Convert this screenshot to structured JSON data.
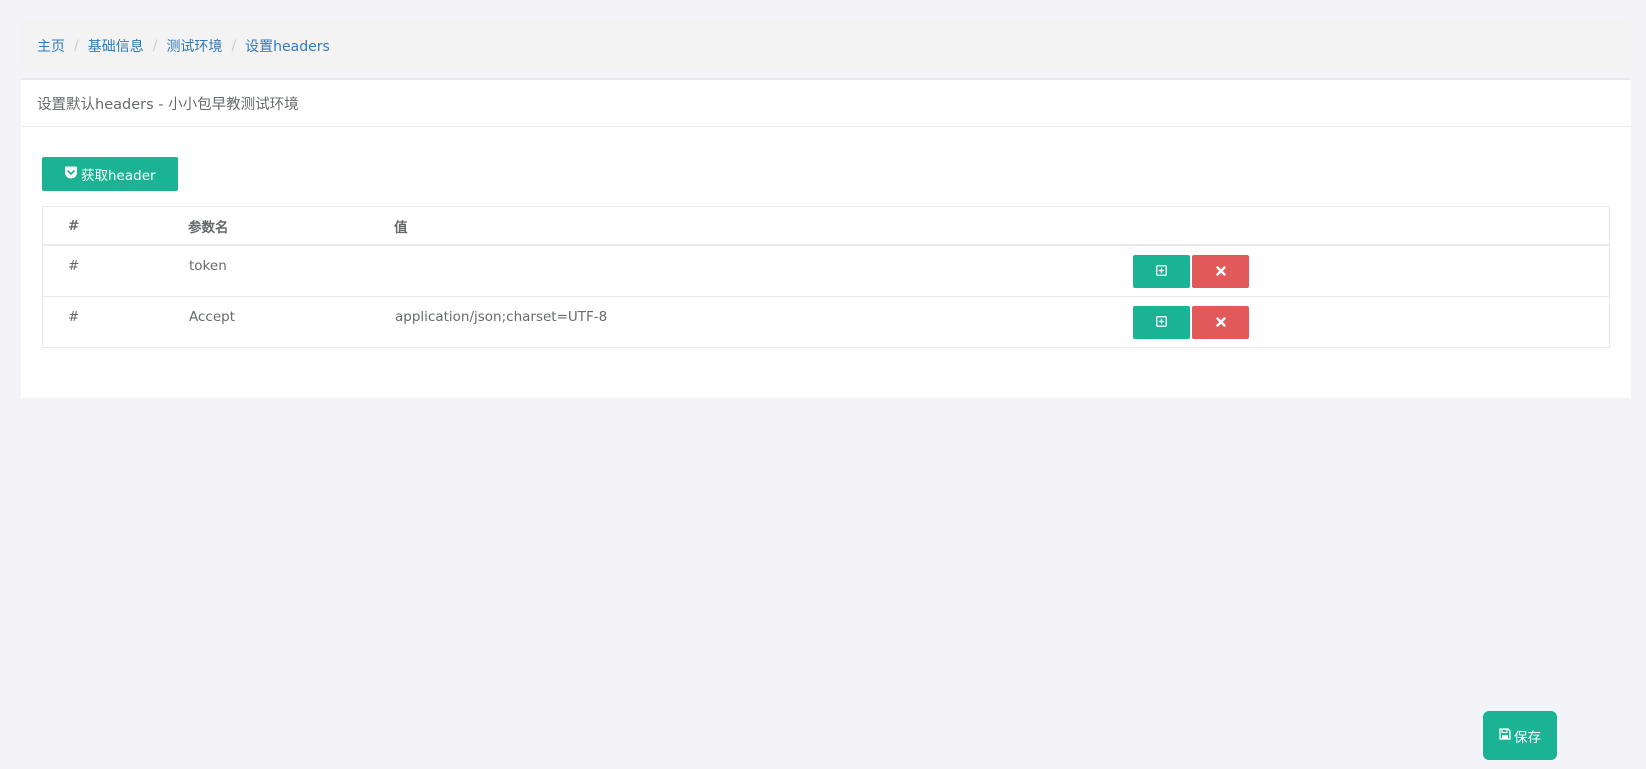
{
  "breadcrumb": {
    "items": [
      "主页",
      "基础信息",
      "测试环境",
      "设置headers"
    ],
    "separator": "/"
  },
  "panel": {
    "title": "设置默认headers - 小小包早教测试环境"
  },
  "toolbar": {
    "fetch_label": "获取header",
    "fetch_icon": "pocket-icon"
  },
  "table": {
    "headers": [
      "#",
      "参数名",
      "值"
    ],
    "rows": [
      {
        "idx": "#",
        "name": "token",
        "value": ""
      },
      {
        "idx": "#",
        "name": "Accept",
        "value": "application/json;charset=UTF-8"
      }
    ],
    "add_icon": "plus-square-icon",
    "delete_icon": "close-icon"
  },
  "footer": {
    "save_label": "保存",
    "save_icon": "floppy-disk-icon"
  },
  "colors": {
    "primary": "#1ab394",
    "danger": "#e05a5a",
    "link": "#337ab7"
  }
}
